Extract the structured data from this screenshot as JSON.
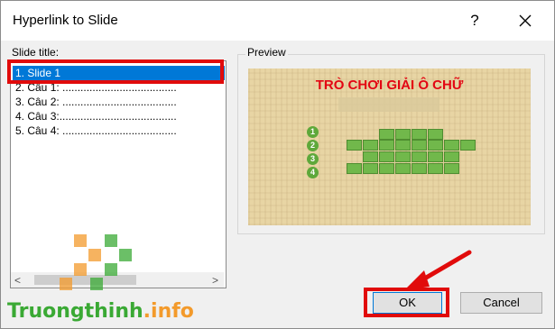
{
  "dialog": {
    "title": "Hyperlink to Slide",
    "help_symbol": "?"
  },
  "slide_list": {
    "label": "Slide title:",
    "items": [
      "1. Slide 1",
      "2. Câu 1: ......................................",
      "3. Câu 2: ......................................",
      "4. Câu 3:.......................................",
      "5. Câu 4: ......................................"
    ],
    "selected_index": 0,
    "scroll_left": "<",
    "scroll_right": ">"
  },
  "preview": {
    "label": "Preview",
    "slide_title": "TRÒ CHƠI GIẢI Ô CHỮ",
    "row_numbers": [
      "1",
      "2",
      "3",
      "4"
    ]
  },
  "buttons": {
    "ok": "OK",
    "cancel": "Cancel"
  },
  "watermark": {
    "name": "Truongthinh",
    "suffix": ".info"
  },
  "colors": {
    "accent": "#0078d7",
    "highlight": "#e10b0b",
    "preview_title": "#e30613",
    "puzzle_cell": "#71b84b"
  }
}
